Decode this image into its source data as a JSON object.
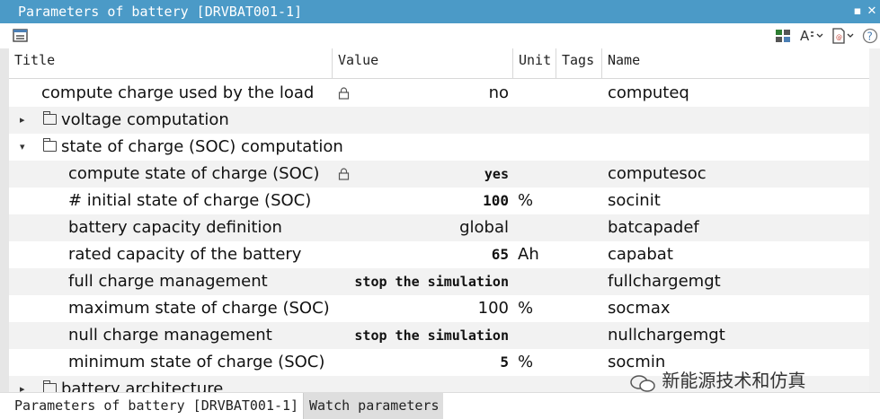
{
  "window": {
    "title": "Parameters of battery [DRVBAT001-1]",
    "pin_icon": "pin-icon",
    "close_icon": "close-icon"
  },
  "toolbar": {
    "left_icon": "parameter-list-icon",
    "right_icons": [
      "layout-icon",
      "text-format-icon",
      "export-icon",
      "help-icon"
    ],
    "help_label": "?"
  },
  "columns": [
    "Title",
    "Value",
    "Unit",
    "Tags",
    "Name"
  ],
  "rows": [
    {
      "title": "compute charge used by the load",
      "value": "no",
      "unit": "",
      "tags": "",
      "name": "computeq",
      "locked": true,
      "bold": false
    },
    {
      "title": "voltage computation",
      "value": "",
      "unit": "",
      "tags": "",
      "name": "",
      "group": true,
      "expanded": false
    },
    {
      "title": "state of charge (SOC) computation",
      "value": "",
      "unit": "",
      "tags": "",
      "name": "",
      "group": true,
      "expanded": true
    },
    {
      "title": "compute state of charge (SOC)",
      "value": "yes",
      "unit": "",
      "tags": "",
      "name": "computesoc",
      "locked": true,
      "bold": true
    },
    {
      "title": "# initial state of charge (SOC)",
      "value": "100",
      "unit": "%",
      "tags": "",
      "name": "socinit",
      "bold": true
    },
    {
      "title": "battery capacity definition",
      "value": "global",
      "unit": "",
      "tags": "",
      "name": "batcapadef",
      "bold": false
    },
    {
      "title": "rated capacity of the battery",
      "value": "65",
      "unit": "Ah",
      "tags": "",
      "name": "capabat",
      "bold": true
    },
    {
      "title": "full charge management",
      "value": "stop the simulation",
      "unit": "",
      "tags": "",
      "name": "fullchargemgt",
      "bold": true
    },
    {
      "title": "maximum state of charge (SOC)",
      "value": "100",
      "unit": "%",
      "tags": "",
      "name": "socmax",
      "bold": false
    },
    {
      "title": "null charge management",
      "value": "stop the simulation",
      "unit": "",
      "tags": "",
      "name": "nullchargemgt",
      "bold": true
    },
    {
      "title": "minimum state of charge (SOC)",
      "value": "5",
      "unit": "%",
      "tags": "",
      "name": "socmin",
      "bold": true
    },
    {
      "title": "battery architecture",
      "value": "",
      "unit": "",
      "tags": "",
      "name": "",
      "group": true,
      "expanded": false
    }
  ],
  "tabs": [
    "Parameters of battery [DRVBAT001-1]",
    "Watch parameters"
  ],
  "watermark": "新能源技术和仿真",
  "colors": {
    "titlebar": "#4b9ac7",
    "active_tab": "#ffffff",
    "inactive_tab": "#dedede",
    "alt_row": "#f2f2f2"
  }
}
